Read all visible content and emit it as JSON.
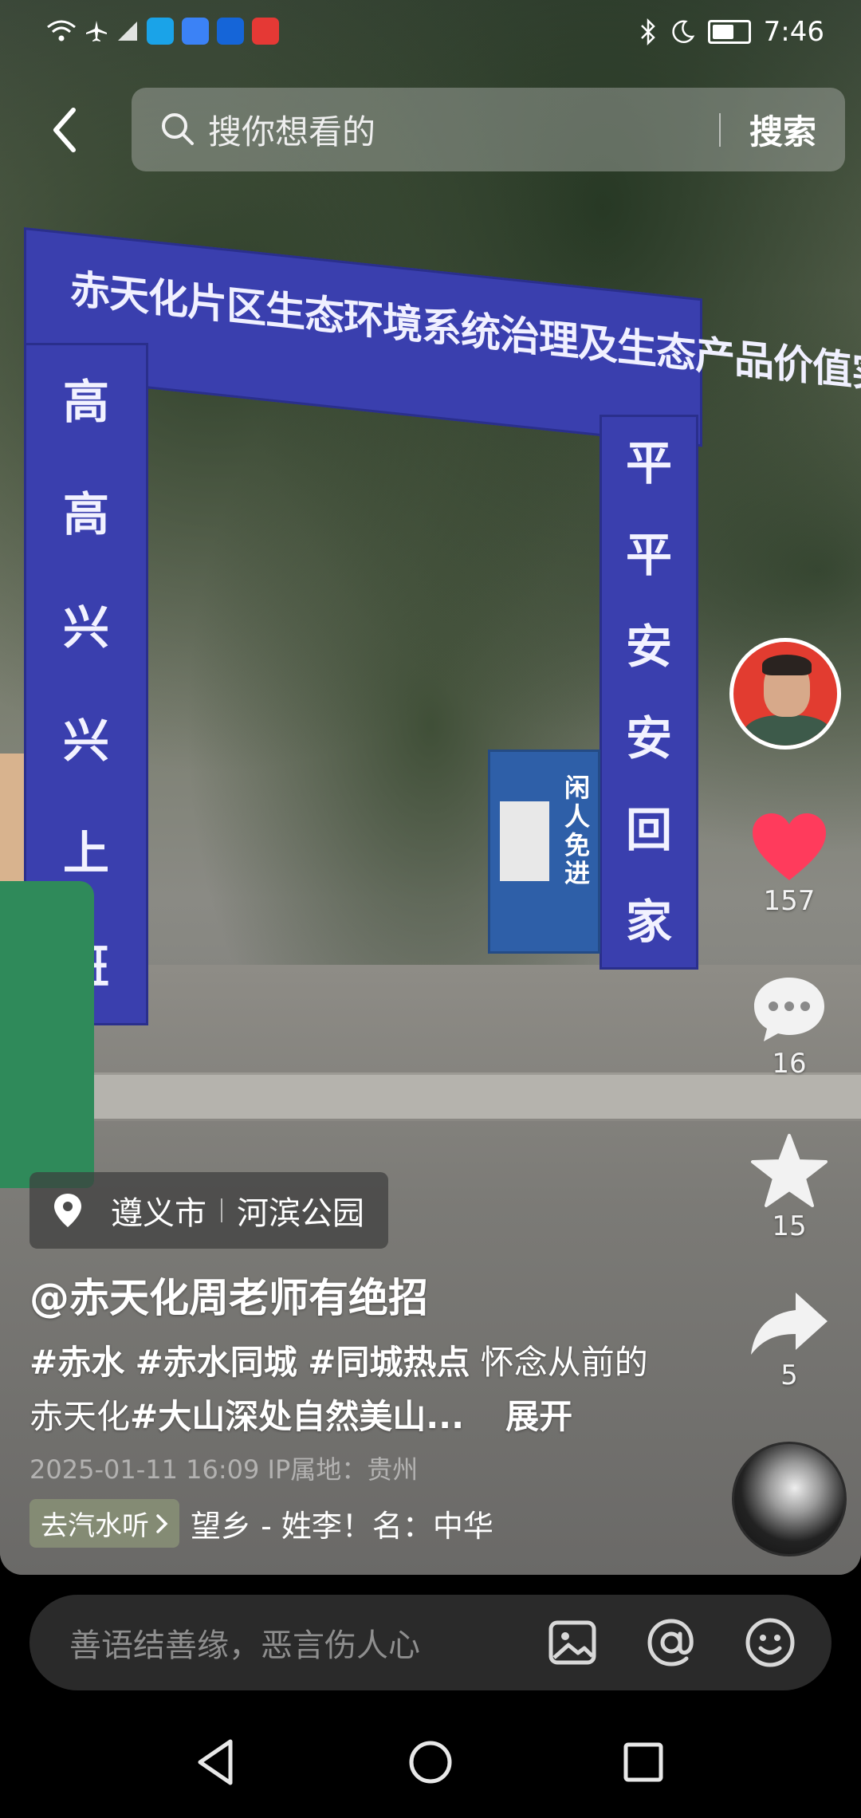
{
  "status_bar": {
    "time": "7:46",
    "left_icons": [
      "wifi-icon",
      "airplane-icon",
      "signal-icon",
      "app-icon-blue",
      "app-icon-cloud",
      "app-icon-c",
      "app-icon-red"
    ],
    "right_icons": [
      "bluetooth-icon",
      "moon-icon",
      "battery-icon"
    ]
  },
  "search": {
    "placeholder": "搜你想看的",
    "button_label": "搜索"
  },
  "video_scene": {
    "arch_banner": "赤天化片区生态环境系统治理及生态产品价值实现项目",
    "left_pillar": [
      "高",
      "高",
      "兴",
      "兴",
      "上",
      "班"
    ],
    "right_pillar": [
      "平",
      "平",
      "安",
      "安",
      "回",
      "家"
    ],
    "sign_board": "闲人免进"
  },
  "actions": {
    "likes": "157",
    "comments": "16",
    "favorites": "15",
    "shares": "5",
    "like_color": "#ff3b5c"
  },
  "location": {
    "city": "遵义市",
    "place": "河滨公园"
  },
  "post": {
    "author": "@赤天化周老师有绝招",
    "tags": [
      "#赤水",
      "#赤水同城",
      "#同城热点"
    ],
    "text_before": "怀念从前的赤天化",
    "tag_inline": "#大山深处自然美山...",
    "expand_label": "展开",
    "meta": "2025-01-11 16:09  IP属地：贵州"
  },
  "music": {
    "prompt": "去汽水听",
    "song": "望乡 - 姓李！名：中华"
  },
  "comment_bar": {
    "placeholder": "善语结善缘，恶言伤人心"
  }
}
